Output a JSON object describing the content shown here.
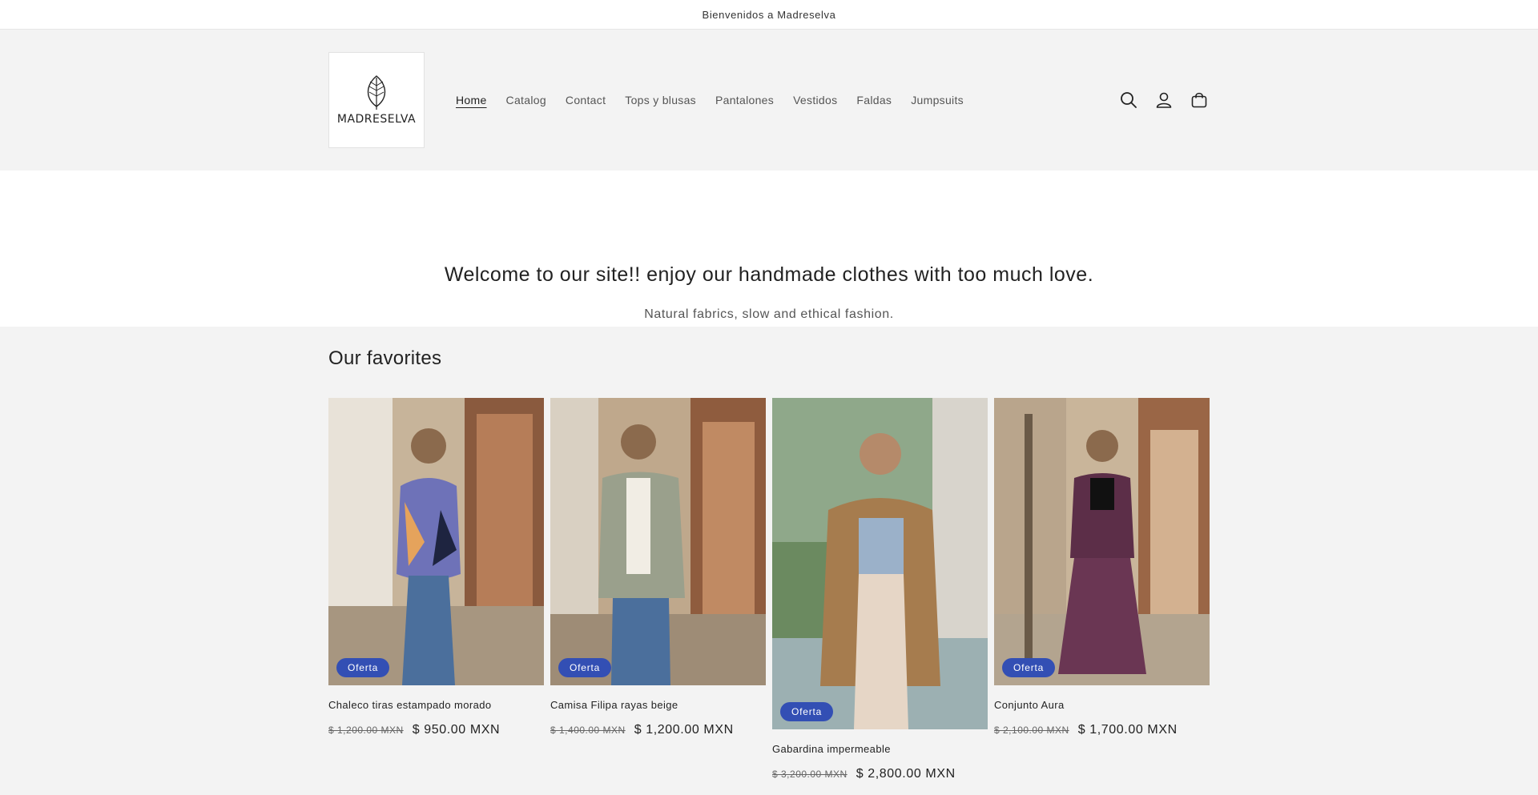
{
  "announcement": {
    "text": "Bienvenidos a Madreselva"
  },
  "header": {
    "logo_text": "MADRESELVA",
    "nav": [
      {
        "label": "Home",
        "active": true
      },
      {
        "label": "Catalog"
      },
      {
        "label": "Contact"
      },
      {
        "label": "Tops y blusas"
      },
      {
        "label": "Pantalones"
      },
      {
        "label": "Vestidos"
      },
      {
        "label": "Faldas"
      },
      {
        "label": "Jumpsuits"
      }
    ],
    "icons": [
      "search-icon",
      "account-icon",
      "cart-icon"
    ]
  },
  "hero": {
    "title": "Welcome to our site!! enjoy our handmade clothes with too much love.",
    "subtitle": "Natural fabrics, slow and ethical fashion."
  },
  "favorites": {
    "title": "Our favorites",
    "products": [
      {
        "badge": "Oferta",
        "title": "Chaleco tiras estampado morado",
        "price_old": "$ 1,200.00 MXN",
        "price_new": "$ 950.00 MXN"
      },
      {
        "badge": "Oferta",
        "title": "Camisa Filipa rayas beige",
        "price_old": "$ 1,400.00 MXN",
        "price_new": "$ 1,200.00 MXN"
      },
      {
        "badge": "Oferta",
        "title": "Gabardina impermeable",
        "price_old": "$ 3,200.00 MXN",
        "price_new": "$ 2,800.00 MXN"
      },
      {
        "badge": "Oferta",
        "title": "Conjunto Aura",
        "price_old": "$ 2,100.00 MXN",
        "price_new": "$ 1,700.00 MXN"
      }
    ]
  },
  "colors": {
    "badge": "#334fb4",
    "header_bg": "#f3f3f3",
    "section_bg": "#f3f3f3"
  }
}
